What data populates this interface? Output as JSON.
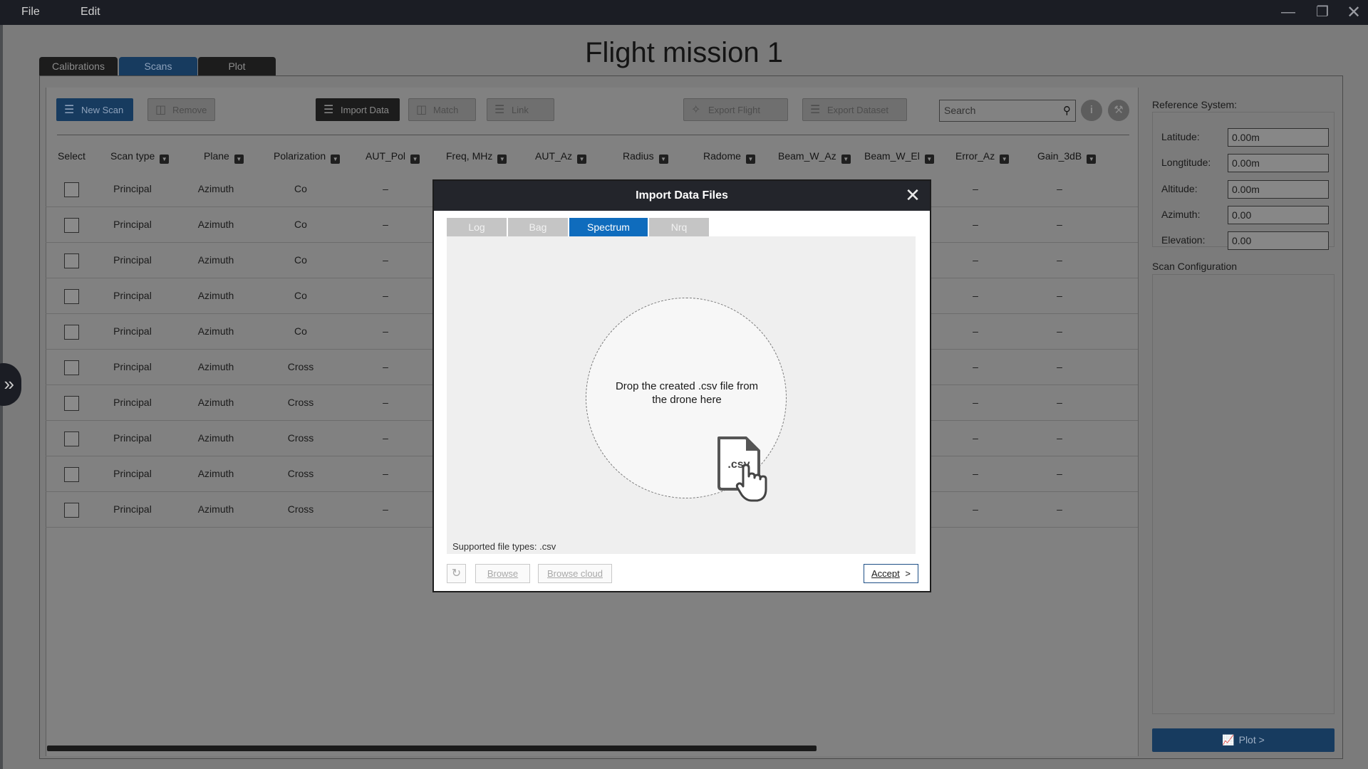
{
  "menu": {
    "file": "File",
    "edit": "Edit"
  },
  "page_title": "Flight mission 1",
  "tabs": [
    {
      "label": "Calibrations",
      "active": false
    },
    {
      "label": "Scans",
      "active": true
    },
    {
      "label": "Plot",
      "active": false
    }
  ],
  "toolbar": {
    "new_scan": "New Scan",
    "remove": "Remove",
    "import_data": "Import Data",
    "match": "Match",
    "link": "Link",
    "export_flight": "Export Flight",
    "export_dataset": "Export Dataset",
    "search_placeholder": "Search"
  },
  "table": {
    "columns": [
      "Select",
      "Scan type",
      "Plane",
      "Polarization",
      "AUT_Pol",
      "Freq, MHz",
      "AUT_Az",
      "Radius",
      "Radome",
      "Beam_W_Az",
      "Beam_W_El",
      "Error_Az",
      "Gain_3dB"
    ],
    "rows": [
      {
        "scan_type": "Principal",
        "plane": "Azimuth",
        "polarization": "Co",
        "aut_pol": "–",
        "error_az": "–",
        "gain": "–"
      },
      {
        "scan_type": "Principal",
        "plane": "Azimuth",
        "polarization": "Co",
        "aut_pol": "–",
        "error_az": "–",
        "gain": "–"
      },
      {
        "scan_type": "Principal",
        "plane": "Azimuth",
        "polarization": "Co",
        "aut_pol": "–",
        "error_az": "–",
        "gain": "–"
      },
      {
        "scan_type": "Principal",
        "plane": "Azimuth",
        "polarization": "Co",
        "aut_pol": "–",
        "error_az": "–",
        "gain": "–"
      },
      {
        "scan_type": "Principal",
        "plane": "Azimuth",
        "polarization": "Co",
        "aut_pol": "–",
        "error_az": "–",
        "gain": "–"
      },
      {
        "scan_type": "Principal",
        "plane": "Azimuth",
        "polarization": "Cross",
        "aut_pol": "–",
        "error_az": "–",
        "gain": "–"
      },
      {
        "scan_type": "Principal",
        "plane": "Azimuth",
        "polarization": "Cross",
        "aut_pol": "–",
        "error_az": "–",
        "gain": "–"
      },
      {
        "scan_type": "Principal",
        "plane": "Azimuth",
        "polarization": "Cross",
        "aut_pol": "–",
        "error_az": "–",
        "gain": "–"
      },
      {
        "scan_type": "Principal",
        "plane": "Azimuth",
        "polarization": "Cross",
        "aut_pol": "–",
        "error_az": "–",
        "gain": "–"
      },
      {
        "scan_type": "Principal",
        "plane": "Azimuth",
        "polarization": "Cross",
        "aut_pol": "–",
        "error_az": "–",
        "gain": "–"
      }
    ]
  },
  "reference_system": {
    "title": "Reference System:",
    "fields": [
      {
        "label": "Latitude:",
        "value": "0.00m"
      },
      {
        "label": "Longtitude:",
        "value": "0.00m"
      },
      {
        "label": "Altitude:",
        "value": "0.00m"
      },
      {
        "label": "Azimuth:",
        "value": "0.00"
      },
      {
        "label": "Elevation:",
        "value": "0.00"
      }
    ]
  },
  "scan_configuration": {
    "title": "Scan Configuration"
  },
  "plot_button": "Plot >",
  "modal": {
    "title": "Import Data Files",
    "tabs": [
      {
        "label": "Log",
        "active": false
      },
      {
        "label": "Bag",
        "active": false
      },
      {
        "label": "Spectrum",
        "active": true
      },
      {
        "label": "Nrq",
        "active": false
      }
    ],
    "drop_text": "Drop the created .csv file from the drone here",
    "file_icon_label": ".csv",
    "supported": "Supported file types: .csv",
    "browse": "Browse",
    "browse_cloud": "Browse cloud",
    "accept": "Accept",
    "accept_chevron": ">"
  },
  "colors": {
    "accent": "#0f6cbd",
    "titlebar": "#1b1d24",
    "overlay_bg": "#7b7b7b"
  }
}
